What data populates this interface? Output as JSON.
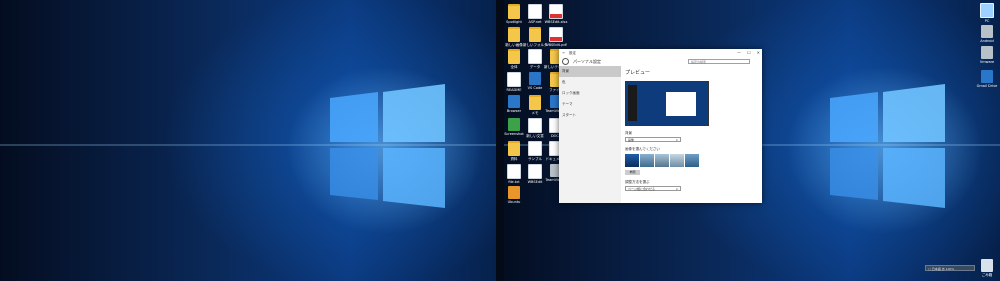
{
  "left_icons": [
    {
      "label": "Spotlight",
      "glyph": "folder"
    },
    {
      "label": "ASP.net",
      "glyph": "file"
    },
    {
      "label": "WBSEdit.xlsx",
      "glyph": "pdf"
    },
    {
      "label": "新しい画像",
      "glyph": "folder"
    },
    {
      "label": "新しいフォルダ",
      "glyph": "folder"
    },
    {
      "label": "WBSEdit.pdf",
      "glyph": "pdf"
    },
    {
      "label": "全体",
      "glyph": "folder"
    },
    {
      "label": "データ",
      "glyph": "file"
    },
    {
      "label": "新しいテキスト",
      "glyph": "folder"
    },
    {
      "label": "README",
      "glyph": "file"
    },
    {
      "label": "VS Code",
      "glyph": "blue"
    },
    {
      "label": "ファイル",
      "glyph": "folder"
    },
    {
      "label": "Browser",
      "glyph": "blue"
    },
    {
      "label": "メモ",
      "glyph": "folder"
    },
    {
      "label": "TeamViewer",
      "glyph": "blue"
    },
    {
      "label": "Screenshot",
      "glyph": "green"
    },
    {
      "label": "新しい文書",
      "glyph": "file"
    },
    {
      "label": "DOCS",
      "glyph": "file"
    },
    {
      "label": "資料",
      "glyph": "folder"
    },
    {
      "label": "サンプル",
      "glyph": "file"
    },
    {
      "label": "ドキュメント",
      "glyph": "file"
    },
    {
      "label": "file.txt",
      "glyph": "file"
    },
    {
      "label": "WBSEdit",
      "glyph": "file"
    },
    {
      "label": "TeamViewer",
      "glyph": "gray"
    },
    {
      "label": "Ubuntu",
      "glyph": "orange"
    }
  ],
  "right_icons": [
    {
      "label": "PC",
      "glyph": "pc"
    },
    {
      "label": "Android",
      "glyph": "gray"
    },
    {
      "label": "Vmware",
      "glyph": "gray"
    },
    {
      "label": "Gmail Drive",
      "glyph": "blue"
    },
    {
      "label": "ごみ箱",
      "glyph": "bin"
    }
  ],
  "window": {
    "titlebar_title": "設定",
    "back": "←",
    "minimize": "—",
    "maximize": "☐",
    "close": "✕",
    "header_title": "パーソナル設定",
    "search_placeholder": "設定の検索",
    "sidebar": [
      {
        "label": "背景",
        "active": true
      },
      {
        "label": "色",
        "active": false
      },
      {
        "label": "ロック画面",
        "active": false
      },
      {
        "label": "テーマ",
        "active": false
      },
      {
        "label": "スタート",
        "active": false
      }
    ],
    "content": {
      "heading": "プレビュー",
      "background_label": "背景",
      "background_value": "画像",
      "choose_picture_label": "画像を選んでください",
      "browse_button": "参照",
      "fit_label": "調整方法を選ぶ",
      "fit_value": "ページ幅に合わせる"
    }
  },
  "tray": {
    "text": "□ 日本語 あ 100%"
  },
  "colors": {
    "wallpaper_blue": "#0b3a80",
    "light_beam": "#6fc3ff",
    "window_bg": "#ffffff",
    "sidebar_bg": "#f2f2f2"
  }
}
